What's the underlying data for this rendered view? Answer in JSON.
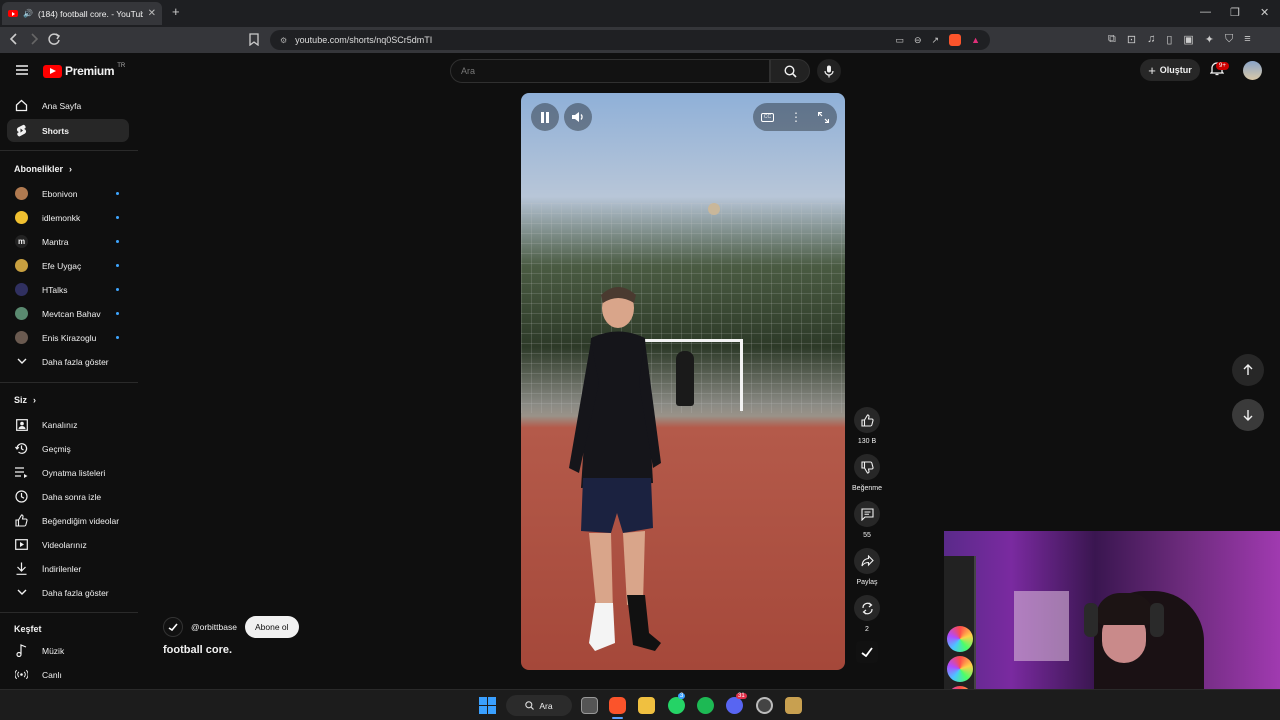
{
  "browser": {
    "tab_title": "(184) football core. - YouTube",
    "url": "youtube.com/shorts/nq0SCr5dmTI"
  },
  "header": {
    "logo_text": "Premium",
    "logo_country": "TR",
    "search_placeholder": "Ara",
    "create_label": "Oluştur",
    "notification_count": "9+"
  },
  "sidebar": {
    "main": [
      {
        "label": "Ana Sayfa",
        "icon": "home-icon"
      },
      {
        "label": "Shorts",
        "icon": "shorts-icon"
      }
    ],
    "subscriptions_heading": "Abonelikler",
    "subscriptions": [
      {
        "label": "Ebonivon",
        "color": "#b07a50"
      },
      {
        "label": "idlemonkk",
        "color": "#f0c030"
      },
      {
        "label": "Mantra",
        "color": "#222222"
      },
      {
        "label": "Efe Uygaç",
        "color": "#c8a040"
      },
      {
        "label": "HTalks",
        "color": "#303060"
      },
      {
        "label": "Mevtcan Bahav",
        "color": "#5a8a70"
      },
      {
        "label": "Enis Kirazoglu",
        "color": "#6a5a50"
      }
    ],
    "subs_more": "Daha fazla göster",
    "you_heading": "Siz",
    "you_items": [
      {
        "label": "Kanalınız"
      },
      {
        "label": "Geçmiş"
      },
      {
        "label": "Oynatma listeleri"
      },
      {
        "label": "Daha sonra izle"
      },
      {
        "label": "Beğendiğim videolar"
      },
      {
        "label": "Videolarınız"
      },
      {
        "label": "İndirilenler"
      },
      {
        "label": "Daha fazla göster"
      }
    ],
    "explore_heading": "Keşfet",
    "explore_items": [
      {
        "label": "Müzik"
      },
      {
        "label": "Canlı"
      }
    ]
  },
  "short": {
    "channel": "@orbittbase",
    "subscribe_label": "Abone ol",
    "title": "football core.",
    "likes": "130 B",
    "dislike_label": "Beğenme",
    "comments": "55",
    "share_label": "Paylaş",
    "remix_count": "2"
  },
  "taskbar": {
    "search_label": "Ara",
    "whatsapp_badge": "3",
    "discord_badge": "31"
  }
}
